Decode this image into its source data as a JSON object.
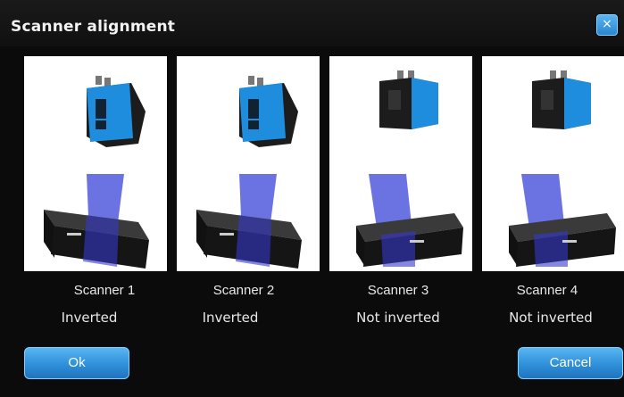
{
  "dialog": {
    "title": "Scanner alignment",
    "close_glyph": "×",
    "close_icon": "close-icon",
    "ok_label": "Ok",
    "cancel_label": "Cancel",
    "accent_color": "#2f8fd9"
  },
  "scanners": [
    {
      "name": "Scanner 1",
      "state": "Inverted"
    },
    {
      "name": "Scanner 2",
      "state": "Inverted"
    },
    {
      "name": "Scanner 3",
      "state": "Not inverted"
    },
    {
      "name": "Scanner 4",
      "state": "Not inverted"
    }
  ]
}
